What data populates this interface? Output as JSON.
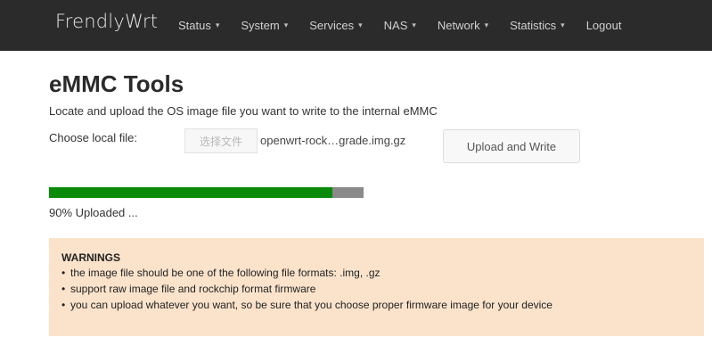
{
  "navbar": {
    "brand": "FrendlyWrt",
    "items": [
      {
        "label": "Status",
        "caret": "▾"
      },
      {
        "label": "System",
        "caret": "▾"
      },
      {
        "label": "Services",
        "caret": "▾"
      },
      {
        "label": "NAS",
        "caret": "▾"
      },
      {
        "label": "Network",
        "caret": "▾"
      },
      {
        "label": "Statistics",
        "caret": "▾"
      }
    ],
    "logout": "Logout"
  },
  "page": {
    "title": "eMMC Tools",
    "description": "Locate and upload the OS image file you want to write to the internal eMMC"
  },
  "file": {
    "label": "Choose local file:",
    "choose_button": "选择文件",
    "file_name": "openwrt-rock…grade.img.gz",
    "upload_button": "Upload and Write"
  },
  "progress": {
    "percent": 90,
    "text": "90% Uploaded ...",
    "fill_color": "#0a8a0a",
    "track_color": "#8a8a8a"
  },
  "warnings": {
    "title": "WARNINGS",
    "items": [
      "the image file should be one of the following file formats: .img, .gz",
      "support raw image file and rockchip format firmware",
      "you can upload whatever you want, so be sure that you choose proper firmware image for your device"
    ],
    "bullet": "•"
  }
}
